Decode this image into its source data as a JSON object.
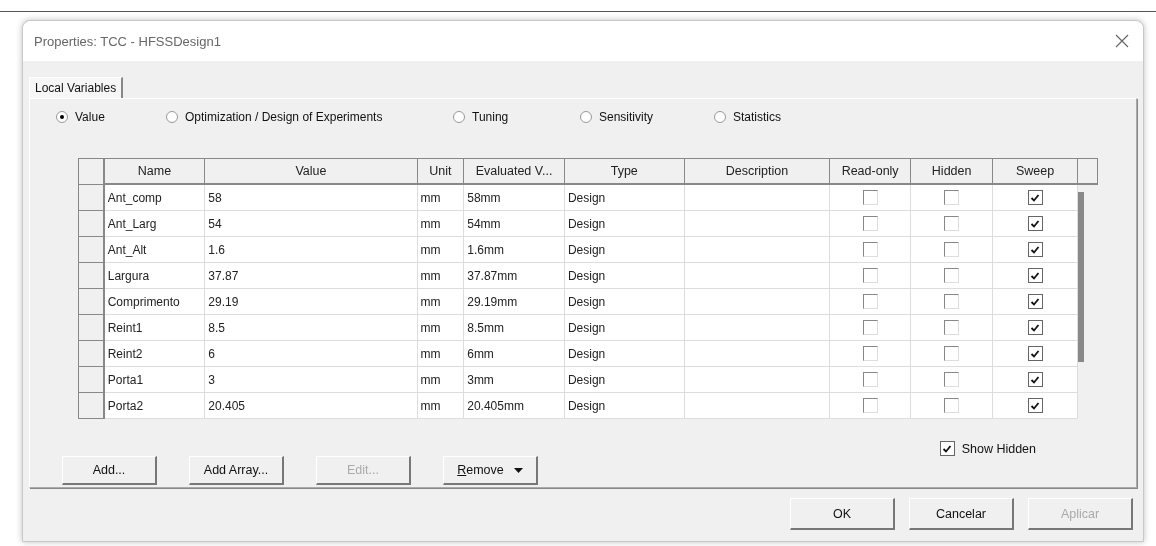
{
  "window": {
    "title": "Properties: TCC - HFSSDesign1"
  },
  "tabs": [
    {
      "label": "Local Variables",
      "selected": true
    }
  ],
  "modes": [
    {
      "label": "Value",
      "selected": true
    },
    {
      "label": "Optimization / Design of Experiments",
      "selected": false
    },
    {
      "label": "Tuning",
      "selected": false
    },
    {
      "label": "Sensitivity",
      "selected": false
    },
    {
      "label": "Statistics",
      "selected": false
    }
  ],
  "table": {
    "columns": [
      "Name",
      "Value",
      "Unit",
      "Evaluated V...",
      "Type",
      "Description",
      "Read-only",
      "Hidden",
      "Sweep"
    ],
    "rows": [
      {
        "name": "Ant_comp",
        "value": "58",
        "unit": "mm",
        "evaluated": "58mm",
        "type": "Design",
        "read_only": false,
        "hidden": false,
        "sweep": true
      },
      {
        "name": "Ant_Larg",
        "value": "54",
        "unit": "mm",
        "evaluated": "54mm",
        "type": "Design",
        "read_only": false,
        "hidden": false,
        "sweep": true
      },
      {
        "name": "Ant_Alt",
        "value": "1.6",
        "unit": "mm",
        "evaluated": "1.6mm",
        "type": "Design",
        "read_only": false,
        "hidden": false,
        "sweep": true
      },
      {
        "name": "Largura",
        "value": "37.87",
        "unit": "mm",
        "evaluated": "37.87mm",
        "type": "Design",
        "read_only": false,
        "hidden": false,
        "sweep": true
      },
      {
        "name": "Comprimento",
        "value": "29.19",
        "unit": "mm",
        "evaluated": "29.19mm",
        "type": "Design",
        "read_only": false,
        "hidden": false,
        "sweep": true
      },
      {
        "name": "Reint1",
        "value": "8.5",
        "unit": "mm",
        "evaluated": "8.5mm",
        "type": "Design",
        "read_only": false,
        "hidden": false,
        "sweep": true
      },
      {
        "name": "Reint2",
        "value": "6",
        "unit": "mm",
        "evaluated": "6mm",
        "type": "Design",
        "read_only": false,
        "hidden": false,
        "sweep": true
      },
      {
        "name": "Porta1",
        "value": "3",
        "unit": "mm",
        "evaluated": "3mm",
        "type": "Design",
        "read_only": false,
        "hidden": false,
        "sweep": true
      },
      {
        "name": "Porta2",
        "value": "20.405",
        "unit": "mm",
        "evaluated": "20.405mm",
        "type": "Design",
        "read_only": false,
        "hidden": false,
        "sweep": true
      }
    ]
  },
  "actions": [
    {
      "label": "Add...",
      "disabled": false,
      "kind": "plain"
    },
    {
      "label": "Add Array...",
      "disabled": false,
      "kind": "plain"
    },
    {
      "label": "Edit...",
      "disabled": true,
      "kind": "plain"
    },
    {
      "label": "Remove",
      "disabled": false,
      "kind": "menu"
    }
  ],
  "show_hidden": {
    "label": "Show Hidden",
    "checked": true
  },
  "footer_buttons": [
    {
      "label": "OK",
      "disabled": false
    },
    {
      "label": "Cancelar",
      "disabled": false
    },
    {
      "label": "Aplicar",
      "disabled": true
    }
  ]
}
